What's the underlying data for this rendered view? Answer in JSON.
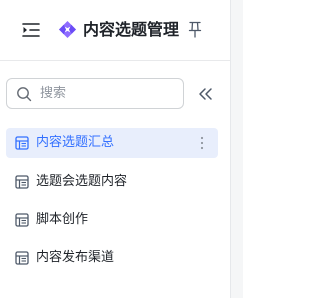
{
  "header": {
    "title": "内容选题管理",
    "logo_color": "#7b61ff"
  },
  "search": {
    "placeholder": "搜索",
    "value": ""
  },
  "nav": {
    "items": [
      {
        "label": "内容选题汇总",
        "active": true
      },
      {
        "label": "选题会选题内容",
        "active": false
      },
      {
        "label": "脚本创作",
        "active": false
      },
      {
        "label": "内容发布渠道",
        "active": false
      }
    ]
  },
  "colors": {
    "accent": "#3370ff",
    "active_bg": "#e8eefc",
    "text": "#1f2329",
    "muted": "#8f959e"
  },
  "icons": {
    "menu": "collapse-menu-icon",
    "logo": "app-logo-icon",
    "pin": "pin-icon",
    "search": "search-icon",
    "fold": "double-chevron-left-icon",
    "nav": "table-icon",
    "more": "more-vertical-icon"
  }
}
